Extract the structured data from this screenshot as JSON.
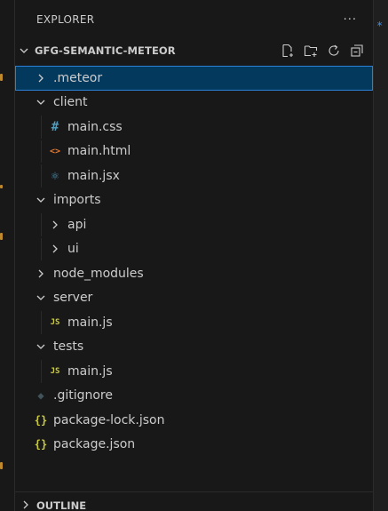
{
  "explorer": {
    "title": "EXPLORER",
    "more": "···"
  },
  "project": {
    "name": "GFG-SEMANTIC-METEOR"
  },
  "tree": [
    {
      "label": ".meteor",
      "depth": 0,
      "kind": "folder",
      "expanded": false,
      "selected": true
    },
    {
      "label": "client",
      "depth": 0,
      "kind": "folder",
      "expanded": true
    },
    {
      "label": "main.css",
      "depth": 1,
      "kind": "css",
      "icon": "#"
    },
    {
      "label": "main.html",
      "depth": 1,
      "kind": "html",
      "icon": "<>"
    },
    {
      "label": "main.jsx",
      "depth": 1,
      "kind": "jsx",
      "icon": "⚛"
    },
    {
      "label": "imports",
      "depth": 0,
      "kind": "folder",
      "expanded": true
    },
    {
      "label": "api",
      "depth": 1,
      "kind": "folder",
      "expanded": false
    },
    {
      "label": "ui",
      "depth": 1,
      "kind": "folder",
      "expanded": false
    },
    {
      "label": "node_modules",
      "depth": 0,
      "kind": "folder",
      "expanded": false
    },
    {
      "label": "server",
      "depth": 0,
      "kind": "folder",
      "expanded": true
    },
    {
      "label": "main.js",
      "depth": 1,
      "kind": "js",
      "icon": "JS"
    },
    {
      "label": "tests",
      "depth": 0,
      "kind": "folder",
      "expanded": true
    },
    {
      "label": "main.js",
      "depth": 1,
      "kind": "js",
      "icon": "JS"
    },
    {
      "label": ".gitignore",
      "depth": 0,
      "kind": "git",
      "icon": "◆"
    },
    {
      "label": "package-lock.json",
      "depth": 0,
      "kind": "json",
      "icon": "{}"
    },
    {
      "label": "package.json",
      "depth": 0,
      "kind": "json",
      "icon": "{}"
    }
  ],
  "outline": {
    "title": "OUTLINE"
  },
  "colors": {
    "selection_bg": "#04395e",
    "selection_border": "#2c7fd6",
    "css_icon": "#519aba",
    "html_icon": "#e37933",
    "jsx_icon": "#519aba",
    "js_icon": "#cbcb41",
    "json_icon": "#cbcb41",
    "git_icon": "#41535b"
  }
}
